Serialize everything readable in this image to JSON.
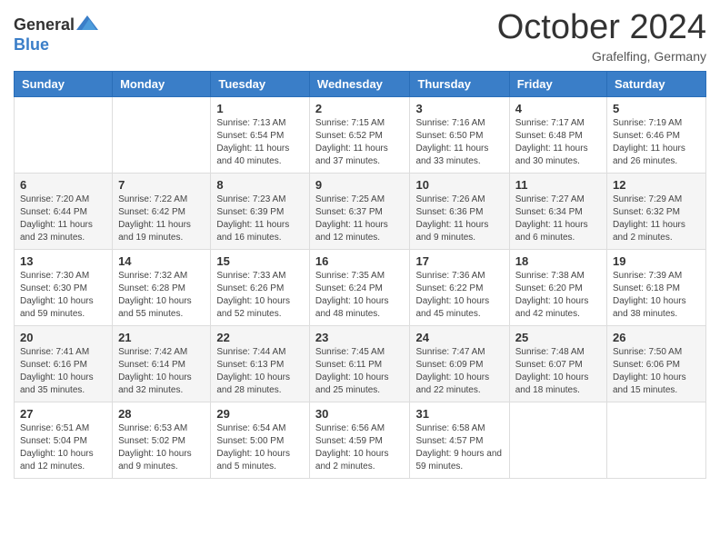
{
  "header": {
    "logo": {
      "text_general": "General",
      "text_blue": "Blue"
    },
    "title": "October 2024",
    "location": "Grafelfing, Germany"
  },
  "calendar": {
    "days_of_week": [
      "Sunday",
      "Monday",
      "Tuesday",
      "Wednesday",
      "Thursday",
      "Friday",
      "Saturday"
    ],
    "weeks": [
      [
        {
          "day": "",
          "info": ""
        },
        {
          "day": "",
          "info": ""
        },
        {
          "day": "1",
          "info": "Sunrise: 7:13 AM\nSunset: 6:54 PM\nDaylight: 11 hours and 40 minutes."
        },
        {
          "day": "2",
          "info": "Sunrise: 7:15 AM\nSunset: 6:52 PM\nDaylight: 11 hours and 37 minutes."
        },
        {
          "day": "3",
          "info": "Sunrise: 7:16 AM\nSunset: 6:50 PM\nDaylight: 11 hours and 33 minutes."
        },
        {
          "day": "4",
          "info": "Sunrise: 7:17 AM\nSunset: 6:48 PM\nDaylight: 11 hours and 30 minutes."
        },
        {
          "day": "5",
          "info": "Sunrise: 7:19 AM\nSunset: 6:46 PM\nDaylight: 11 hours and 26 minutes."
        }
      ],
      [
        {
          "day": "6",
          "info": "Sunrise: 7:20 AM\nSunset: 6:44 PM\nDaylight: 11 hours and 23 minutes."
        },
        {
          "day": "7",
          "info": "Sunrise: 7:22 AM\nSunset: 6:42 PM\nDaylight: 11 hours and 19 minutes."
        },
        {
          "day": "8",
          "info": "Sunrise: 7:23 AM\nSunset: 6:39 PM\nDaylight: 11 hours and 16 minutes."
        },
        {
          "day": "9",
          "info": "Sunrise: 7:25 AM\nSunset: 6:37 PM\nDaylight: 11 hours and 12 minutes."
        },
        {
          "day": "10",
          "info": "Sunrise: 7:26 AM\nSunset: 6:36 PM\nDaylight: 11 hours and 9 minutes."
        },
        {
          "day": "11",
          "info": "Sunrise: 7:27 AM\nSunset: 6:34 PM\nDaylight: 11 hours and 6 minutes."
        },
        {
          "day": "12",
          "info": "Sunrise: 7:29 AM\nSunset: 6:32 PM\nDaylight: 11 hours and 2 minutes."
        }
      ],
      [
        {
          "day": "13",
          "info": "Sunrise: 7:30 AM\nSunset: 6:30 PM\nDaylight: 10 hours and 59 minutes."
        },
        {
          "day": "14",
          "info": "Sunrise: 7:32 AM\nSunset: 6:28 PM\nDaylight: 10 hours and 55 minutes."
        },
        {
          "day": "15",
          "info": "Sunrise: 7:33 AM\nSunset: 6:26 PM\nDaylight: 10 hours and 52 minutes."
        },
        {
          "day": "16",
          "info": "Sunrise: 7:35 AM\nSunset: 6:24 PM\nDaylight: 10 hours and 48 minutes."
        },
        {
          "day": "17",
          "info": "Sunrise: 7:36 AM\nSunset: 6:22 PM\nDaylight: 10 hours and 45 minutes."
        },
        {
          "day": "18",
          "info": "Sunrise: 7:38 AM\nSunset: 6:20 PM\nDaylight: 10 hours and 42 minutes."
        },
        {
          "day": "19",
          "info": "Sunrise: 7:39 AM\nSunset: 6:18 PM\nDaylight: 10 hours and 38 minutes."
        }
      ],
      [
        {
          "day": "20",
          "info": "Sunrise: 7:41 AM\nSunset: 6:16 PM\nDaylight: 10 hours and 35 minutes."
        },
        {
          "day": "21",
          "info": "Sunrise: 7:42 AM\nSunset: 6:14 PM\nDaylight: 10 hours and 32 minutes."
        },
        {
          "day": "22",
          "info": "Sunrise: 7:44 AM\nSunset: 6:13 PM\nDaylight: 10 hours and 28 minutes."
        },
        {
          "day": "23",
          "info": "Sunrise: 7:45 AM\nSunset: 6:11 PM\nDaylight: 10 hours and 25 minutes."
        },
        {
          "day": "24",
          "info": "Sunrise: 7:47 AM\nSunset: 6:09 PM\nDaylight: 10 hours and 22 minutes."
        },
        {
          "day": "25",
          "info": "Sunrise: 7:48 AM\nSunset: 6:07 PM\nDaylight: 10 hours and 18 minutes."
        },
        {
          "day": "26",
          "info": "Sunrise: 7:50 AM\nSunset: 6:06 PM\nDaylight: 10 hours and 15 minutes."
        }
      ],
      [
        {
          "day": "27",
          "info": "Sunrise: 6:51 AM\nSunset: 5:04 PM\nDaylight: 10 hours and 12 minutes."
        },
        {
          "day": "28",
          "info": "Sunrise: 6:53 AM\nSunset: 5:02 PM\nDaylight: 10 hours and 9 minutes."
        },
        {
          "day": "29",
          "info": "Sunrise: 6:54 AM\nSunset: 5:00 PM\nDaylight: 10 hours and 5 minutes."
        },
        {
          "day": "30",
          "info": "Sunrise: 6:56 AM\nSunset: 4:59 PM\nDaylight: 10 hours and 2 minutes."
        },
        {
          "day": "31",
          "info": "Sunrise: 6:58 AM\nSunset: 4:57 PM\nDaylight: 9 hours and 59 minutes."
        },
        {
          "day": "",
          "info": ""
        },
        {
          "day": "",
          "info": ""
        }
      ]
    ]
  }
}
